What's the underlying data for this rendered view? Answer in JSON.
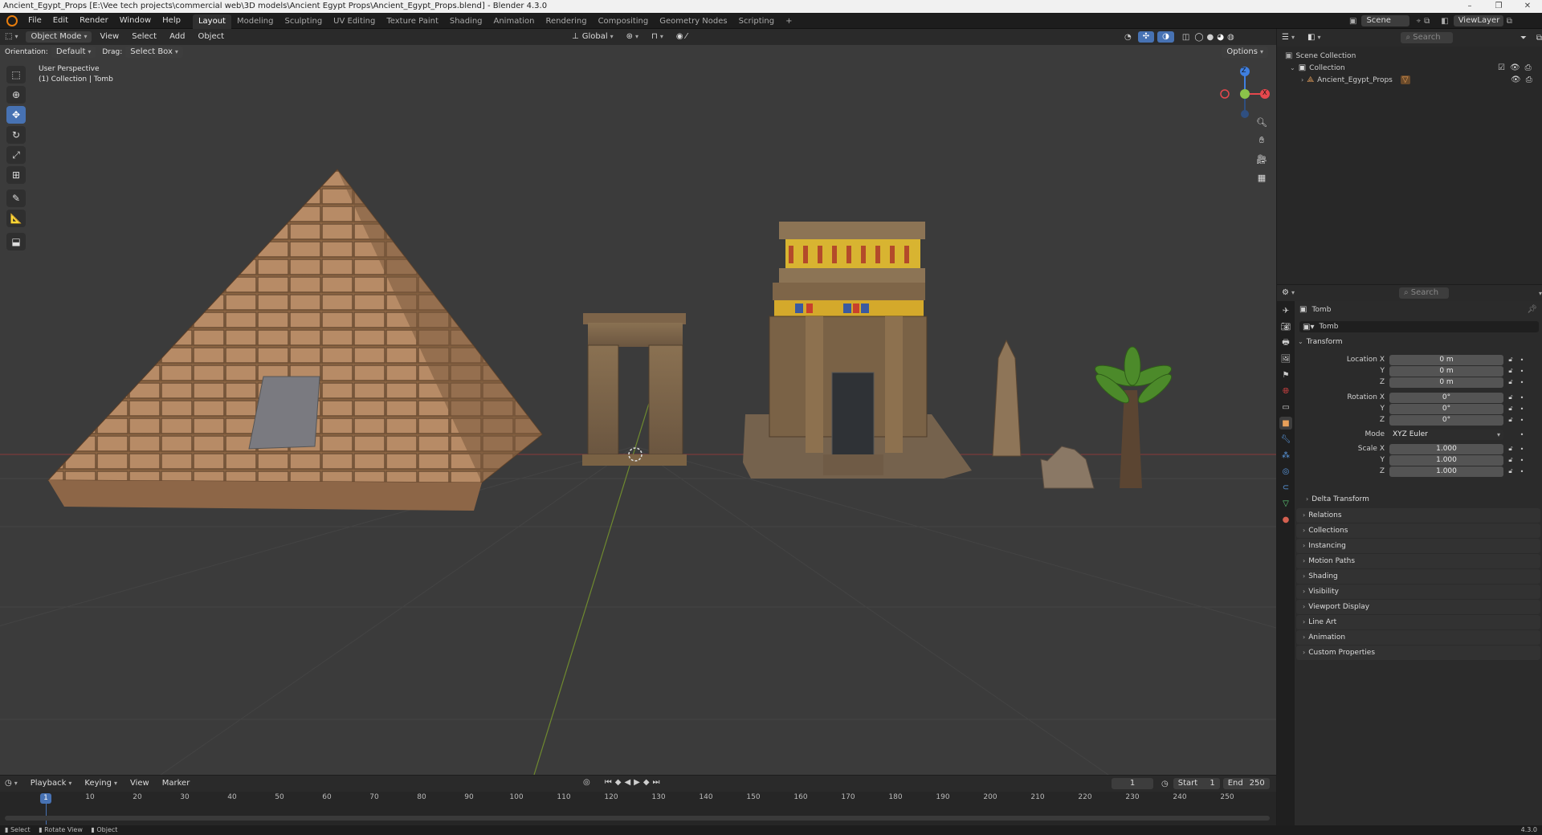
{
  "window": {
    "title": "Ancient_Egypt_Props [E:\\Vee tech projects\\commercial web\\3D models\\Ancient Egypt Props\\Ancient_Egypt_Props.blend] - Blender 4.3.0",
    "controls": [
      "–",
      "❐",
      "✕"
    ]
  },
  "menu": {
    "items": [
      "File",
      "Edit",
      "Render",
      "Window",
      "Help"
    ],
    "workspaces": [
      "Layout",
      "Modeling",
      "Sculpting",
      "UV Editing",
      "Texture Paint",
      "Shading",
      "Animation",
      "Rendering",
      "Compositing",
      "Geometry Nodes",
      "Scripting",
      "+"
    ],
    "scene_label": "Scene",
    "viewlayer_label": "ViewLayer"
  },
  "viewport": {
    "mode": "Object Mode",
    "menus": [
      "View",
      "Select",
      "Add",
      "Object"
    ],
    "transform_orientation": "Global",
    "orientation_label": "Orientation:",
    "orientation_value": "Default",
    "drag_label": "Drag:",
    "drag_value": "Select Box",
    "options_label": "Options",
    "overlay_line1": "User Perspective",
    "overlay_line2": "(1) Collection | Tomb",
    "gizmo": {
      "z": "Z",
      "x": "X"
    }
  },
  "outliner": {
    "search_placeholder": "Search",
    "items": [
      {
        "label": "Scene Collection"
      },
      {
        "label": "Collection"
      },
      {
        "label": "Ancient_Egypt_Props"
      }
    ]
  },
  "properties": {
    "search_placeholder": "Search",
    "object_name": "Tomb",
    "object_field": "Tomb",
    "transform_panel": "Transform",
    "location": {
      "label": "Location X",
      "x": "0 m",
      "y": "0 m",
      "z": "0 m"
    },
    "rotation": {
      "label": "Rotation X",
      "x": "0°",
      "y": "0°",
      "z": "0°"
    },
    "mode": {
      "label": "Mode",
      "value": "XYZ Euler"
    },
    "scale": {
      "label": "Scale X",
      "x": "1.000",
      "y": "1.000",
      "z": "1.000"
    },
    "axis_labels": {
      "y": "Y",
      "z": "Z"
    },
    "delta_transform": "Delta Transform",
    "panels": [
      "Relations",
      "Collections",
      "Instancing",
      "Motion Paths",
      "Shading",
      "Visibility",
      "Viewport Display",
      "Line Art",
      "Animation",
      "Custom Properties"
    ]
  },
  "timeline": {
    "menus": [
      "Playback",
      "Keying",
      "View",
      "Marker"
    ],
    "current_frame": "1",
    "start_label": "Start",
    "start": "1",
    "end_label": "End",
    "end": "250",
    "playhead": "1",
    "ticks": [
      "10",
      "20",
      "30",
      "40",
      "50",
      "60",
      "70",
      "80",
      "90",
      "100",
      "110",
      "120",
      "130",
      "140",
      "150",
      "160",
      "170",
      "180",
      "190",
      "200",
      "210",
      "220",
      "230",
      "240",
      "250"
    ]
  },
  "statusbar": {
    "items": [
      "Select",
      "Rotate View",
      "Object"
    ],
    "version": "4.3.0"
  },
  "colors": {
    "accent": "#4772b3",
    "blender_orange": "#e87d0d",
    "x_axis": "#e5484d",
    "y_axis": "#8bc34a",
    "z_axis": "#3f7fe0"
  }
}
